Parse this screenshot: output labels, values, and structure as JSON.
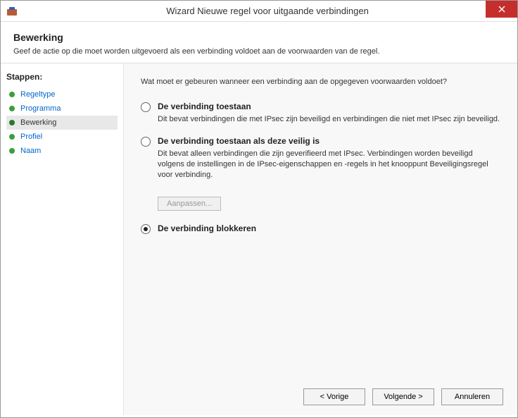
{
  "window": {
    "title": "Wizard Nieuwe regel voor uitgaande verbindingen"
  },
  "header": {
    "title": "Bewerking",
    "description": "Geef de actie op die moet worden uitgevoerd als een verbinding voldoet aan de voorwaarden van de regel."
  },
  "sidebar": {
    "title": "Stappen:",
    "steps": [
      {
        "label": "Regeltype",
        "active": false
      },
      {
        "label": "Programma",
        "active": false
      },
      {
        "label": "Bewerking",
        "active": true
      },
      {
        "label": "Profiel",
        "active": false
      },
      {
        "label": "Naam",
        "active": false
      }
    ]
  },
  "main": {
    "question": "Wat moet er gebeuren wanneer een verbinding aan de opgegeven voorwaarden voldoet?",
    "options": [
      {
        "title": "De verbinding toestaan",
        "description": "Dit bevat verbindingen die met IPsec zijn beveiligd en verbindingen die niet met IPsec zijn beveiligd.",
        "selected": false
      },
      {
        "title": "De verbinding toestaan als deze veilig is",
        "description": "Dit bevat alleen verbindingen die zijn geverifieerd met IPsec. Verbindingen worden beveiligd volgens de instellingen in de IPsec-eigenschappen en -regels in het knooppunt Beveiligingsregel voor verbinding.",
        "selected": false,
        "customize": "Aanpassen..."
      },
      {
        "title": "De verbinding blokkeren",
        "description": "",
        "selected": true
      }
    ]
  },
  "footer": {
    "back": "< Vorige",
    "next": "Volgende >",
    "cancel": "Annuleren"
  }
}
